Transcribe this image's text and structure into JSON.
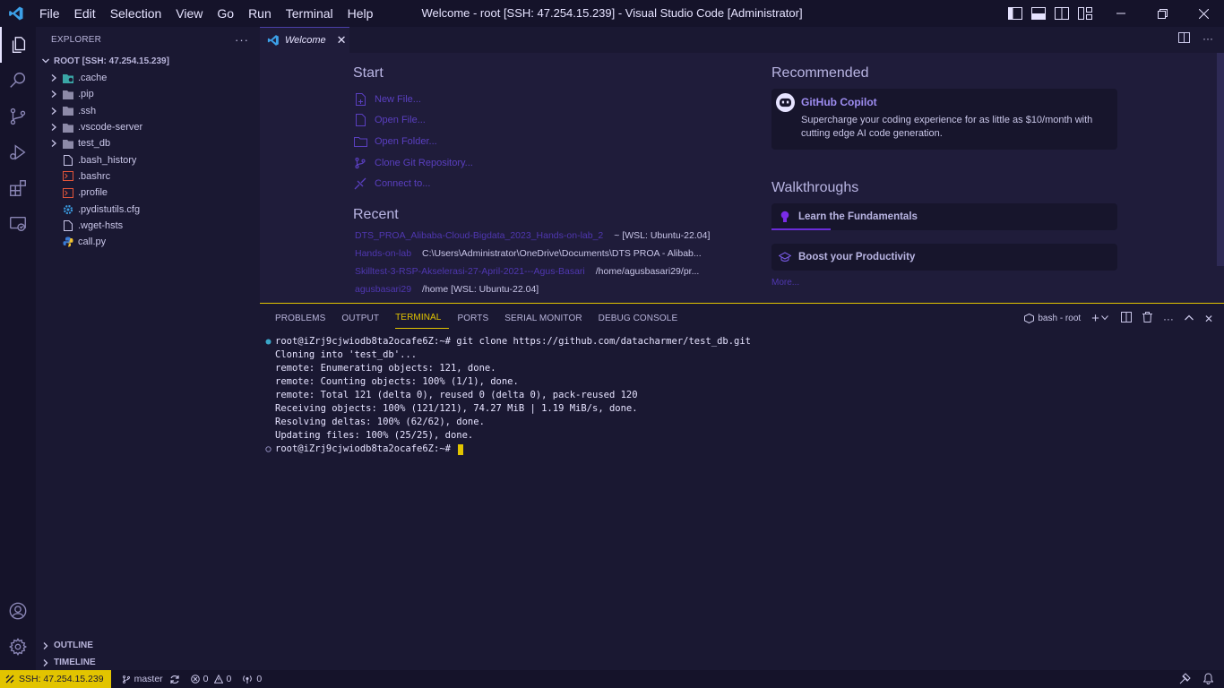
{
  "titlebar": {
    "menu": [
      "File",
      "Edit",
      "Selection",
      "View",
      "Go",
      "Run",
      "Terminal",
      "Help"
    ],
    "window_title": "Welcome - root [SSH: 47.254.15.239] - Visual Studio Code [Administrator]"
  },
  "sidebar": {
    "header": "EXPLORER",
    "root": "ROOT [SSH: 47.254.15.239]",
    "items": [
      {
        "label": ".cache",
        "type": "folder",
        "icon": "folder-icon"
      },
      {
        "label": ".pip",
        "type": "folder",
        "icon": "folder-icon"
      },
      {
        "label": ".ssh",
        "type": "folder",
        "icon": "folder-icon"
      },
      {
        "label": ".vscode-server",
        "type": "folder",
        "icon": "folder-icon"
      },
      {
        "label": "test_db",
        "type": "folder",
        "icon": "folder-icon"
      },
      {
        "label": ".bash_history",
        "type": "file",
        "icon": "file-icon"
      },
      {
        "label": ".bashrc",
        "type": "file",
        "icon": "shell-file-icon"
      },
      {
        "label": ".profile",
        "type": "file",
        "icon": "shell-file-icon"
      },
      {
        "label": ".pydistutils.cfg",
        "type": "file",
        "icon": "gear-file-icon"
      },
      {
        "label": ".wget-hsts",
        "type": "file",
        "icon": "file-icon"
      },
      {
        "label": "call.py",
        "type": "file",
        "icon": "python-file-icon"
      }
    ],
    "outline": "OUTLINE",
    "timeline": "TIMELINE"
  },
  "tabs": [
    {
      "label": "Welcome",
      "active": true
    }
  ],
  "welcome": {
    "start_heading": "Start",
    "start_items": [
      "New File...",
      "Open File...",
      "Open Folder...",
      "Clone Git Repository...",
      "Connect to..."
    ],
    "recent_heading": "Recent",
    "recent": [
      {
        "name": "DTS_PROA_Alibaba-Cloud-Bigdata_2023_Hands-on-lab_2",
        "path": "~ [WSL: Ubuntu-22.04]"
      },
      {
        "name": "Hands-on-lab",
        "path": "C:\\Users\\Administrator\\OneDrive\\Documents\\DTS PROA - Alibab..."
      },
      {
        "name": "Skilltest-3-RSP-Akselerasi-27-April-2021---Agus-Basari",
        "path": "/home/agusbasari29/pr..."
      },
      {
        "name": "agusbasari29",
        "path": "/home [WSL: Ubuntu-22.04]"
      }
    ],
    "recommended_heading": "Recommended",
    "copilot_title": "GitHub Copilot",
    "copilot_desc": "Supercharge your coding experience for as little as $10/month with cutting edge AI code generation.",
    "walkthroughs_heading": "Walkthroughs",
    "walkthroughs": [
      {
        "label": "Learn the Fundamentals",
        "progress": 0.17
      },
      {
        "label": "Boost your Productivity"
      }
    ],
    "more": "More..."
  },
  "panel": {
    "tabs": [
      "PROBLEMS",
      "OUTPUT",
      "TERMINAL",
      "PORTS",
      "SERIAL MONITOR",
      "DEBUG CONSOLE"
    ],
    "active_tab": "TERMINAL",
    "terminal_name": "bash - root",
    "terminal_lines": [
      "root@iZrj9cjwiodb8ta2ocafe6Z:~# git clone https://github.com/datacharmer/test_db.git",
      "Cloning into 'test_db'...",
      "remote: Enumerating objects: 121, done.",
      "remote: Counting objects: 100% (1/1), done.",
      "remote: Total 121 (delta 0), reused 0 (delta 0), pack-reused 120",
      "Receiving objects: 100% (121/121), 74.27 MiB | 1.19 MiB/s, done.",
      "Resolving deltas: 100% (62/62), done.",
      "Updating files: 100% (25/25), done.",
      "root@iZrj9cjwiodb8ta2ocafe6Z:~# "
    ]
  },
  "statusbar": {
    "remote": "SSH: 47.254.15.239",
    "branch": "master",
    "errors": "0",
    "warnings": "0",
    "ports": "0"
  },
  "colors": {
    "accent": "#e2c400",
    "link": "#5a3fc0",
    "background": "#1f1c3a"
  }
}
